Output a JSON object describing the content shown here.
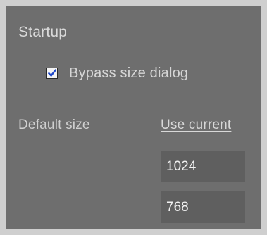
{
  "startup": {
    "title": "Startup",
    "bypass_checkbox": {
      "label": "Bypass size dialog",
      "checked": true
    },
    "default_size": {
      "label": "Default size",
      "use_current_label": "Use current",
      "width": "1024",
      "height": "768"
    }
  },
  "colors": {
    "panel_bg": "#6e6e6e",
    "input_bg": "#5f5f5f",
    "text": "#d6d6d6",
    "check_mark": "#1e47c9"
  }
}
